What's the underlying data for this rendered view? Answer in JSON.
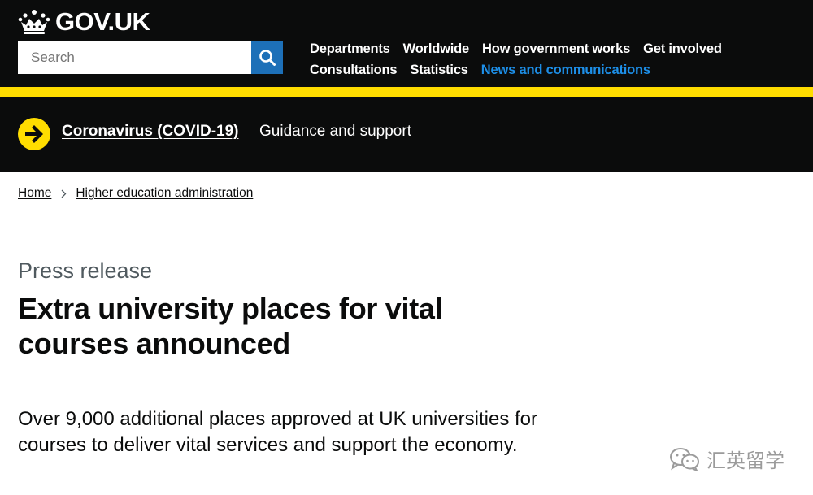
{
  "header": {
    "logo_text": "GOV.UK",
    "search": {
      "placeholder": "Search",
      "value": "Search"
    },
    "nav_row1": [
      "Departments",
      "Worldwide",
      "How government works",
      "Get involved"
    ],
    "nav_row2": [
      "Consultations",
      "Statistics",
      "News and communications"
    ],
    "active_nav": "News and communications"
  },
  "covid_banner": {
    "link": "Coronavirus (COVID-19)",
    "text": "Guidance and support"
  },
  "breadcrumbs": [
    "Home",
    "Higher education administration"
  ],
  "article": {
    "caption": "Press release",
    "title": "Extra university places for vital courses announced",
    "lede": "Over 9,000 additional places approved at UK universities for courses to deliver vital services and support the economy."
  },
  "watermark": {
    "text": "汇英留学",
    "icon": "wechat-icon"
  },
  "colors": {
    "header_bg": "#0b0c0c",
    "stripe": "#ffdd00",
    "search_button": "#1d70b8",
    "active_link": "#1d8fe8",
    "caption": "#505a5f"
  }
}
